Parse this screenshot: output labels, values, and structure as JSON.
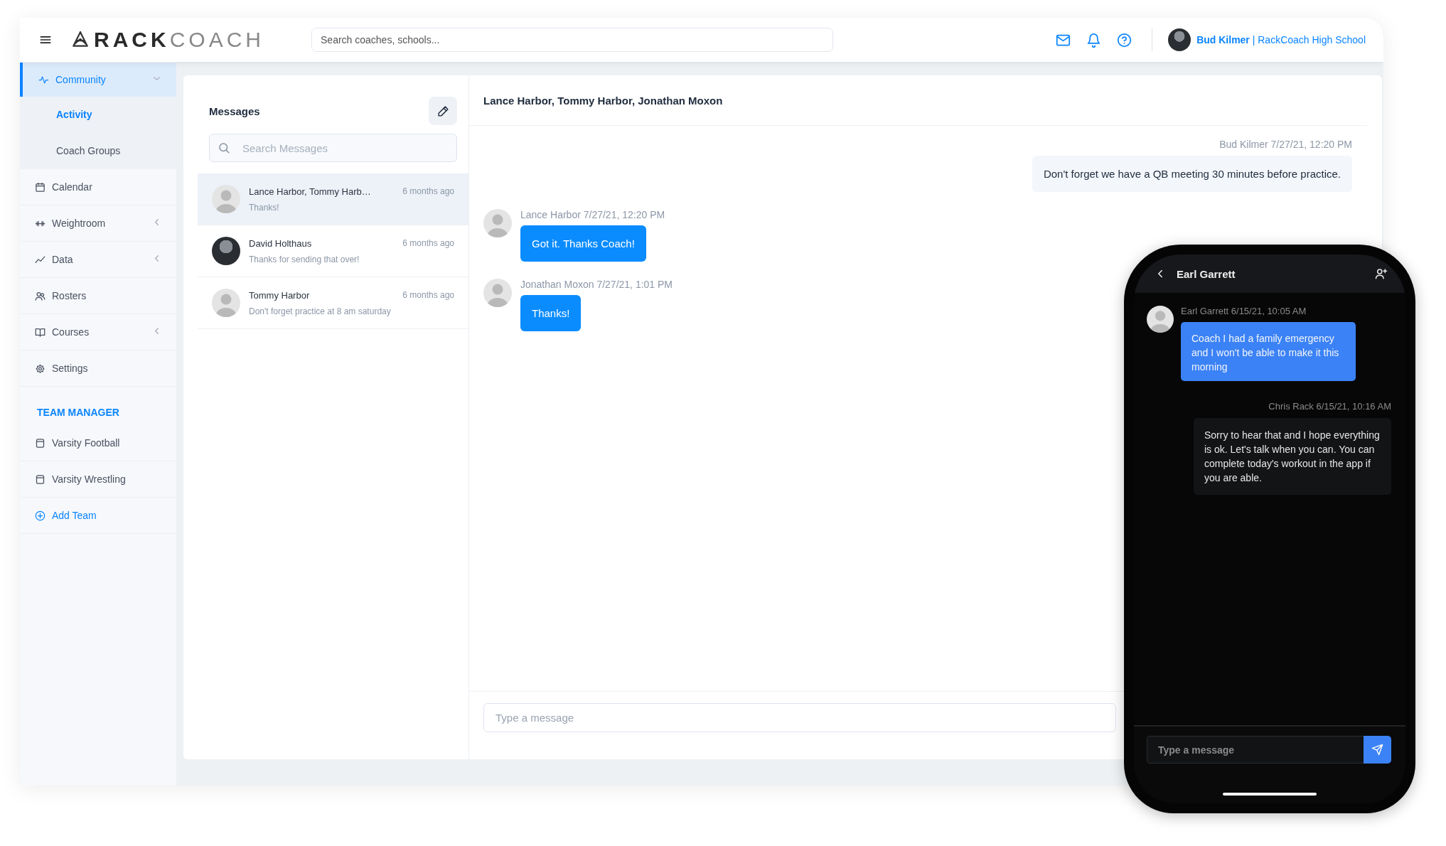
{
  "header": {
    "logo": {
      "primary": "RACK",
      "secondary": "COACH"
    },
    "search": {
      "placeholder": "Search coaches, schools..."
    },
    "user": "**Bud Kilmer** | RackCoach High School"
  },
  "sidebar": {
    "items": [
      {
        "label": "Community",
        "selected": true,
        "expanded": true,
        "children": [
          {
            "label": "Activity",
            "selected": true
          },
          {
            "label": "Coach Groups",
            "selected": false
          }
        ]
      },
      {
        "label": "Calendar",
        "selected": false
      },
      {
        "label": "Weightroom",
        "selected": false,
        "expanded": false
      },
      {
        "label": "Data",
        "selected": false,
        "expanded": false
      },
      {
        "label": "Rosters",
        "selected": false
      },
      {
        "label": "Courses",
        "selected": false,
        "expanded": false
      },
      {
        "label": "Settings",
        "selected": false
      }
    ],
    "team_manager": {
      "heading": "TEAM MANAGER",
      "teams": [
        {
          "label": "Varsity Football"
        },
        {
          "label": "Varsity Wrestling"
        }
      ],
      "add_button": "Add Team"
    }
  },
  "messages": {
    "title": "Messages",
    "search": {
      "placeholder": "Search Messages"
    },
    "conversations": [
      {
        "name": "Lance Harbor, Tommy Harb…",
        "preview": "Thanks!",
        "time": "6 months ago",
        "selected": true,
        "kind": "default"
      },
      {
        "name": "David Holthaus",
        "preview": "Thanks for sending that over!",
        "time": "6 months ago",
        "selected": false,
        "kind": "photo"
      },
      {
        "name": "Tommy Harbor",
        "preview": "Don't forget practice at 8 am saturday",
        "time": "6 months ago",
        "selected": false,
        "kind": "default"
      }
    ]
  },
  "chat": {
    "title": "Lance Harbor, Tommy Harbor, Jonathan Moxon",
    "messages": [
      {
        "kind": "outgoing",
        "meta": "Bud Kilmer 7/27/21, 12:20 PM",
        "text": "Don't forget we have a QB meeting 30 minutes before practice."
      },
      {
        "kind": "incoming",
        "meta": "Lance Harbor 7/27/21, 12:20 PM",
        "text": "Got it. Thanks Coach!"
      },
      {
        "kind": "incoming",
        "meta": "Jonathan Moxon 7/27/21, 1:01 PM",
        "text": "Thanks!"
      }
    ],
    "composer": {
      "placeholder": "Type a message"
    }
  },
  "phone": {
    "title": "Earl Garrett",
    "messages": [
      {
        "kind": "incoming",
        "meta": "Earl Garrett 6/15/21, 10:05 AM",
        "text": "Coach I had a family emergency and I won't be able to make it this morning"
      },
      {
        "kind": "outgoing",
        "meta": "Chris Rack 6/15/21, 10:16 AM",
        "text": "Sorry to hear that and I hope everything is ok. Let's talk when you can. You can complete today's workout in the app if you are able."
      }
    ],
    "composer": {
      "placeholder": "Type a message"
    }
  }
}
